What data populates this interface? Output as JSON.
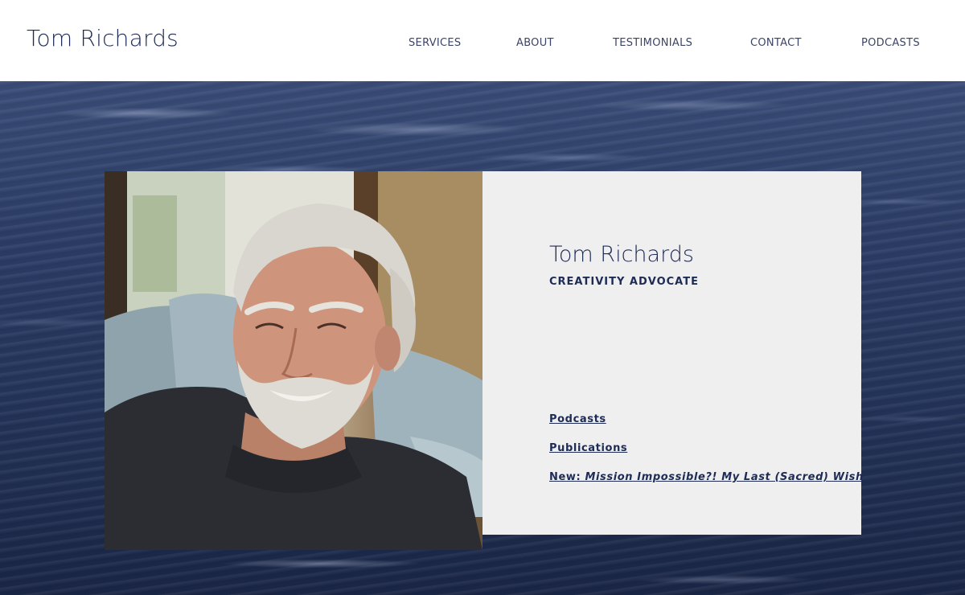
{
  "header": {
    "site_title": "Tom Richards",
    "nav": [
      "SERVICES",
      "ABOUT",
      "TESTIMONIALS",
      "CONTACT",
      "PODCASTS"
    ]
  },
  "profile": {
    "name": "Tom Richards",
    "role": "CREATIVITY ADVOCATE",
    "links": {
      "podcasts": "Podcasts",
      "publications": "Publications",
      "new_prefix": "New: ",
      "new_title": "Mission Impossible?! My Last (Sacred) Wish"
    }
  },
  "colors": {
    "brand_navy": "#1d2b55",
    "card_bg": "#efefef",
    "header_bg": "#ffffff"
  }
}
